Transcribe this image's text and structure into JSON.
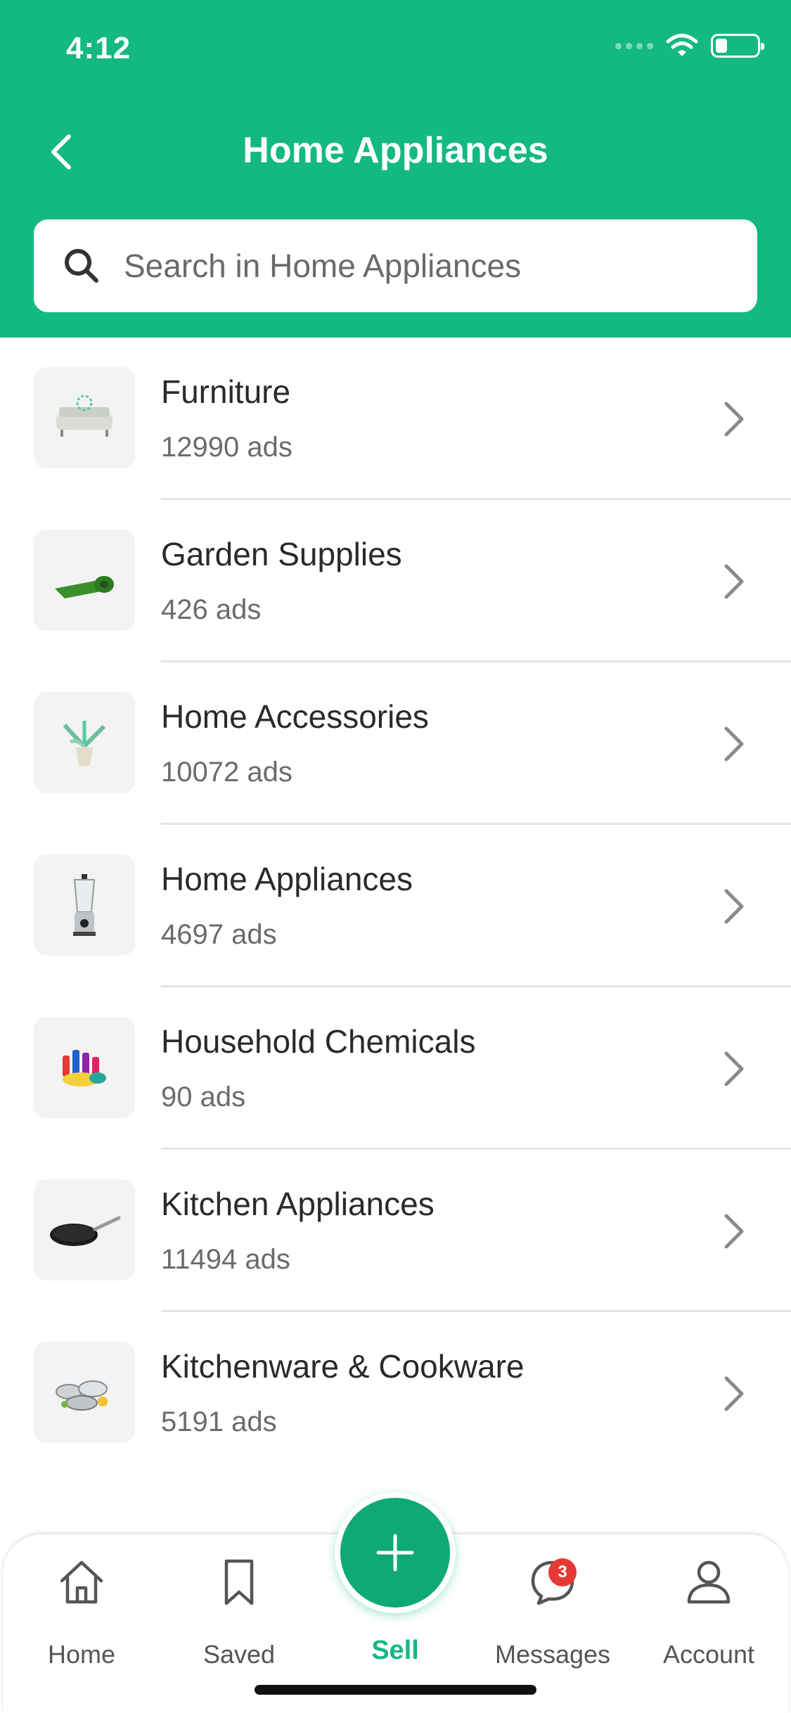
{
  "status_bar": {
    "time": "4:12"
  },
  "header": {
    "title": "Home Appliances",
    "back_icon": "chevron-left-icon"
  },
  "search": {
    "placeholder": "Search in Home Appliances",
    "icon": "search-icon"
  },
  "categories": [
    {
      "title": "Furniture",
      "count": "12990 ads",
      "thumb": "sofa-thumbnail"
    },
    {
      "title": "Garden Supplies",
      "count": "426 ads",
      "thumb": "grass-roll-thumbnail"
    },
    {
      "title": "Home Accessories",
      "count": "10072 ads",
      "thumb": "plant-pot-thumbnail"
    },
    {
      "title": "Home Appliances",
      "count": "4697 ads",
      "thumb": "blender-thumbnail"
    },
    {
      "title": "Household Chemicals",
      "count": "90 ads",
      "thumb": "cleaning-supplies-thumbnail"
    },
    {
      "title": "Kitchen Appliances",
      "count": "11494 ads",
      "thumb": "frying-pan-thumbnail"
    },
    {
      "title": "Kitchenware & Cookware",
      "count": "5191 ads",
      "thumb": "cookware-set-thumbnail"
    }
  ],
  "tabbar": {
    "home": "Home",
    "saved": "Saved",
    "sell": "Sell",
    "messages": "Messages",
    "messages_badge": "3",
    "account": "Account"
  },
  "colors": {
    "brand": "#13b981",
    "badge": "#e53935"
  }
}
